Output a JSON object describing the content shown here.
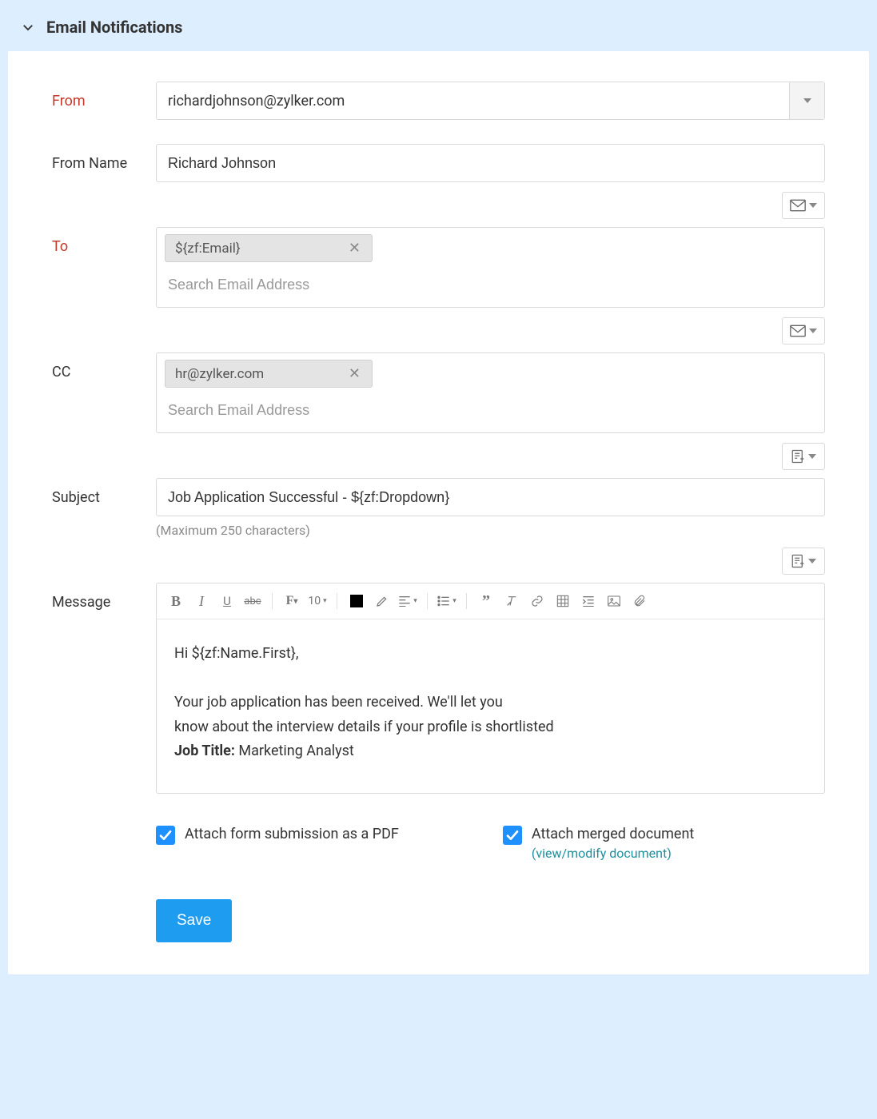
{
  "section_title": "Email Notifications",
  "labels": {
    "from": "From",
    "from_name": "From Name",
    "to": "To",
    "cc": "CC",
    "subject": "Subject",
    "message": "Message"
  },
  "from": {
    "value": "richardjohnson@zylker.com"
  },
  "from_name": {
    "value": "Richard Johnson"
  },
  "to": {
    "chip": "${zf:Email}",
    "search_placeholder": "Search Email Address"
  },
  "cc": {
    "chip": "hr@zylker.com",
    "search_placeholder": "Search Email Address"
  },
  "subject": {
    "value": "Job Application Successful - ${zf:Dropdown}",
    "hint": "(Maximum 250 characters)"
  },
  "message": {
    "toolbar": {
      "font_size": "10"
    },
    "greeting": "Hi ${zf:Name.First},",
    "body_line1": "Your job application has been received. We'll let you",
    "body_line2": "know about the interview details if your profile is shortlisted",
    "job_title_label": "Job Title:",
    "job_title_value": "Marketing Analyst"
  },
  "options": {
    "attach_pdf": "Attach form submission as a PDF",
    "attach_merged": "Attach merged document",
    "view_modify": "(view/modify document)"
  },
  "save_label": "Save"
}
